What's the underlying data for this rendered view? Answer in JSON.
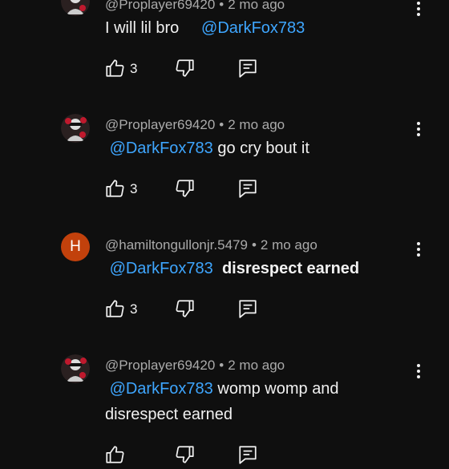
{
  "comments": [
    {
      "author": "@Proplayer69420",
      "age": "2 mo ago",
      "mention": "@DarkFox783",
      "mention_first": false,
      "text": "I will lil bro",
      "text_bold": false,
      "likes": "3",
      "avatar_type": "image"
    },
    {
      "author": "@Proplayer69420",
      "age": "2 mo ago",
      "mention": "@DarkFox783",
      "mention_first": true,
      "text": "go cry bout it",
      "text_bold": false,
      "likes": "3",
      "avatar_type": "image"
    },
    {
      "author": "@hamiltongullonjr.5479",
      "age": "2 mo ago",
      "mention": "@DarkFox783",
      "mention_first": true,
      "text": "disrespect earned",
      "text_bold": true,
      "likes": "3",
      "avatar_type": "letter",
      "avatar_letter": "H",
      "avatar_color": "#c2410c"
    },
    {
      "author": "@Proplayer69420",
      "age": "2 mo ago",
      "mention": "@DarkFox783",
      "mention_first": true,
      "text": "womp womp and disrespect earned",
      "text_bold": false,
      "likes": "",
      "avatar_type": "image"
    }
  ],
  "meta_separator": "•",
  "colors": {
    "background": "#0f0f0f",
    "mention": "#3ea6ff",
    "meta": "#aaaaaa",
    "text": "#f1f1f1"
  },
  "icons": [
    "like-icon",
    "dislike-icon",
    "reply-icon",
    "more-vert-icon"
  ]
}
